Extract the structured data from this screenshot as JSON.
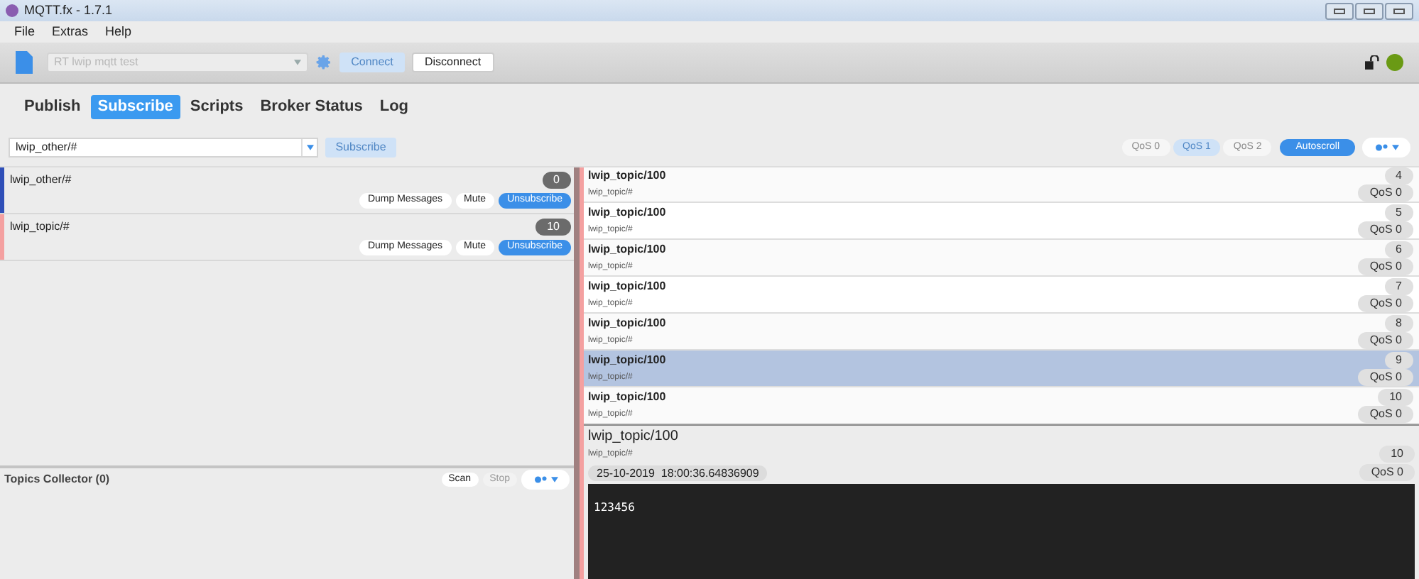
{
  "window": {
    "title": "MQTT.fx - 1.7.1"
  },
  "menu": [
    "File",
    "Extras",
    "Help"
  ],
  "toolbar": {
    "profile": {
      "placeholder": "RT lwip mqtt test"
    },
    "connect": {
      "label": "Connect",
      "disabled": true
    },
    "disconnect": {
      "label": "Disconnect",
      "disabled": false
    },
    "connected": true
  },
  "tabs": [
    {
      "label": "Publish",
      "selected": false
    },
    {
      "label": "Subscribe",
      "selected": true
    },
    {
      "label": "Scripts",
      "selected": false
    },
    {
      "label": "Broker Status",
      "selected": false
    },
    {
      "label": "Log",
      "selected": false
    }
  ],
  "subscribe_bar": {
    "topic": "lwip_other/#",
    "button": {
      "label": "Subscribe",
      "disabled": true
    },
    "qos": [
      {
        "label": "QoS 0",
        "selected": false
      },
      {
        "label": "QoS 1",
        "selected": true
      },
      {
        "label": "QoS 2",
        "selected": false
      }
    ],
    "autoscroll": {
      "label": "Autoscroll",
      "on": true
    }
  },
  "subscriptions": [
    {
      "topic": "lwip_other/#",
      "count": "0",
      "color": "#2f4fb8",
      "buttons": [
        "Dump Messages",
        "Mute",
        "Unsubscribe"
      ]
    },
    {
      "topic": "lwip_topic/#",
      "count": "10",
      "color": "#f4a0a0",
      "buttons": [
        "Dump Messages",
        "Mute",
        "Unsubscribe"
      ]
    }
  ],
  "topics_collector": {
    "title": "Topics Collector (0)",
    "scan": {
      "label": "Scan",
      "disabled": false
    },
    "stop": {
      "label": "Stop",
      "disabled": true
    }
  },
  "messages": [
    {
      "topic": "lwip_topic/100",
      "subscription": "lwip_topic/#",
      "number": "4",
      "qos": "QoS 0",
      "selected": false
    },
    {
      "topic": "lwip_topic/100",
      "subscription": "lwip_topic/#",
      "number": "5",
      "qos": "QoS 0",
      "selected": false
    },
    {
      "topic": "lwip_topic/100",
      "subscription": "lwip_topic/#",
      "number": "6",
      "qos": "QoS 0",
      "selected": false
    },
    {
      "topic": "lwip_topic/100",
      "subscription": "lwip_topic/#",
      "number": "7",
      "qos": "QoS 0",
      "selected": false
    },
    {
      "topic": "lwip_topic/100",
      "subscription": "lwip_topic/#",
      "number": "8",
      "qos": "QoS 0",
      "selected": false
    },
    {
      "topic": "lwip_topic/100",
      "subscription": "lwip_topic/#",
      "number": "9",
      "qos": "QoS 0",
      "selected": true
    },
    {
      "topic": "lwip_topic/100",
      "subscription": "lwip_topic/#",
      "number": "10",
      "qos": "QoS 0",
      "selected": false
    }
  ],
  "detail": {
    "topic": "lwip_topic/100",
    "subscription": "lwip_topic/#",
    "number": "10",
    "timestamp": "25-10-2019  18:00:36.64836909",
    "qos": "QoS 0",
    "payload": "123456"
  }
}
